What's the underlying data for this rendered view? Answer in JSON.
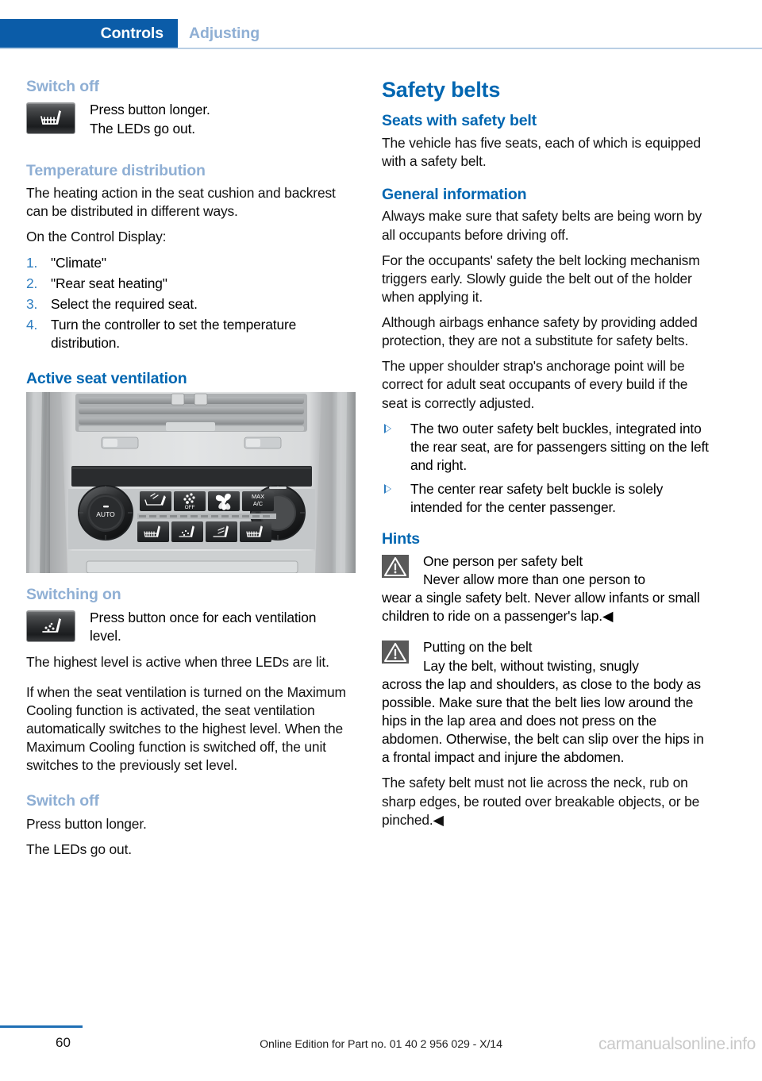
{
  "header": {
    "active_tab": "Controls",
    "inactive_tab": "Adjusting",
    "accent_blue": "#0b5ca8",
    "muted_blue": "#8fafd4"
  },
  "left_column": {
    "switch_off_heading_1": "Switch off",
    "switch_off_button_line1": "Press button longer.",
    "switch_off_button_line2": "The LEDs go out.",
    "seat_heating_icon": "seat-heating-button-icon",
    "temperature_distribution_heading": "Temperature distribution",
    "temperature_distribution_p1": "The heating action in the seat cushion and backrest can be distributed in different ways.",
    "temperature_distribution_p2": "On the Control Display:",
    "steps": [
      {
        "num": "1.",
        "text": "\"Climate\""
      },
      {
        "num": "2.",
        "text": "\"Rear seat heating\""
      },
      {
        "num": "3.",
        "text": "Select the required seat."
      },
      {
        "num": "4.",
        "text": "Turn the controller to set the temperature distribution."
      }
    ],
    "active_seat_ventilation_heading": "Active seat ventilation",
    "figure_caption": "climate-control-panel-photo",
    "switching_on_heading": "Switching on",
    "ventilation_icon": "seat-ventilation-button-icon",
    "switching_on_button_line1": "Press button once for each ventilation",
    "switching_on_button_line2": "level.",
    "switching_on_p1": "The highest level is active when three LEDs are lit.",
    "switching_on_p2": "If when the seat ventilation is turned on the Maximum Cooling function is activated, the seat ventilation automatically switches to the highest level. When the Maximum Cooling function is switched off, the unit switches to the previously set level.",
    "switch_off_heading_2": "Switch off",
    "switch_off_p1": "Press button longer.",
    "switch_off_p2": "The LEDs go out."
  },
  "right_column": {
    "title": "Safety belts",
    "seats_heading": "Seats with safety belt",
    "seats_p1": "The vehicle has five seats, each of which is equipped with a safety belt.",
    "general_heading": "General information",
    "general_p1": "Always make sure that safety belts are being worn by all occupants before driving off.",
    "general_p2": "For the occupants' safety the belt locking mechanism triggers early. Slowly guide the belt out of the holder when applying it.",
    "general_p3": "Although airbags enhance safety by providing added protection, they are not a substitute for safety belts.",
    "general_p4": "The upper shoulder strap's anchorage point will be correct for adult seat occupants of every build if the seat is correctly adjusted.",
    "bullets": [
      "The two outer safety belt buckles, integrated into the rear seat, are for passengers sitting on the left and right.",
      "The center rear safety belt buckle is solely intended for the center passenger."
    ],
    "hints_heading": "Hints",
    "warnings": [
      {
        "icon": "warning-triangle-icon",
        "title": "One person per safety belt",
        "first_line": "Never allow more than one person to",
        "body": "wear a single safety belt. Never allow infants or small children to ride on a passenger's lap.◀"
      },
      {
        "icon": "warning-triangle-icon",
        "title": "Putting on the belt",
        "first_line": "Lay the belt, without twisting, snugly",
        "body": "across the lap and shoulders, as close to the body as possible. Make sure that the belt lies low around the hips in the lap area and does not press on the abdomen. Otherwise, the belt can slip over the hips in a frontal impact and injure the abdomen."
      }
    ],
    "closing_p": "The safety belt must not lie across the neck, rub on sharp edges, be routed over breakable objects, or be pinched.◀"
  },
  "figure_labels": {
    "auto": "AUTO",
    "off": "OFF",
    "max": "MAX",
    "ac": "A/C"
  },
  "footer": {
    "page_number": "60",
    "edition_text": "Online Edition for Part no. 01 40 2 956 029 - X/14",
    "watermark": "carmanualsonline.info"
  }
}
